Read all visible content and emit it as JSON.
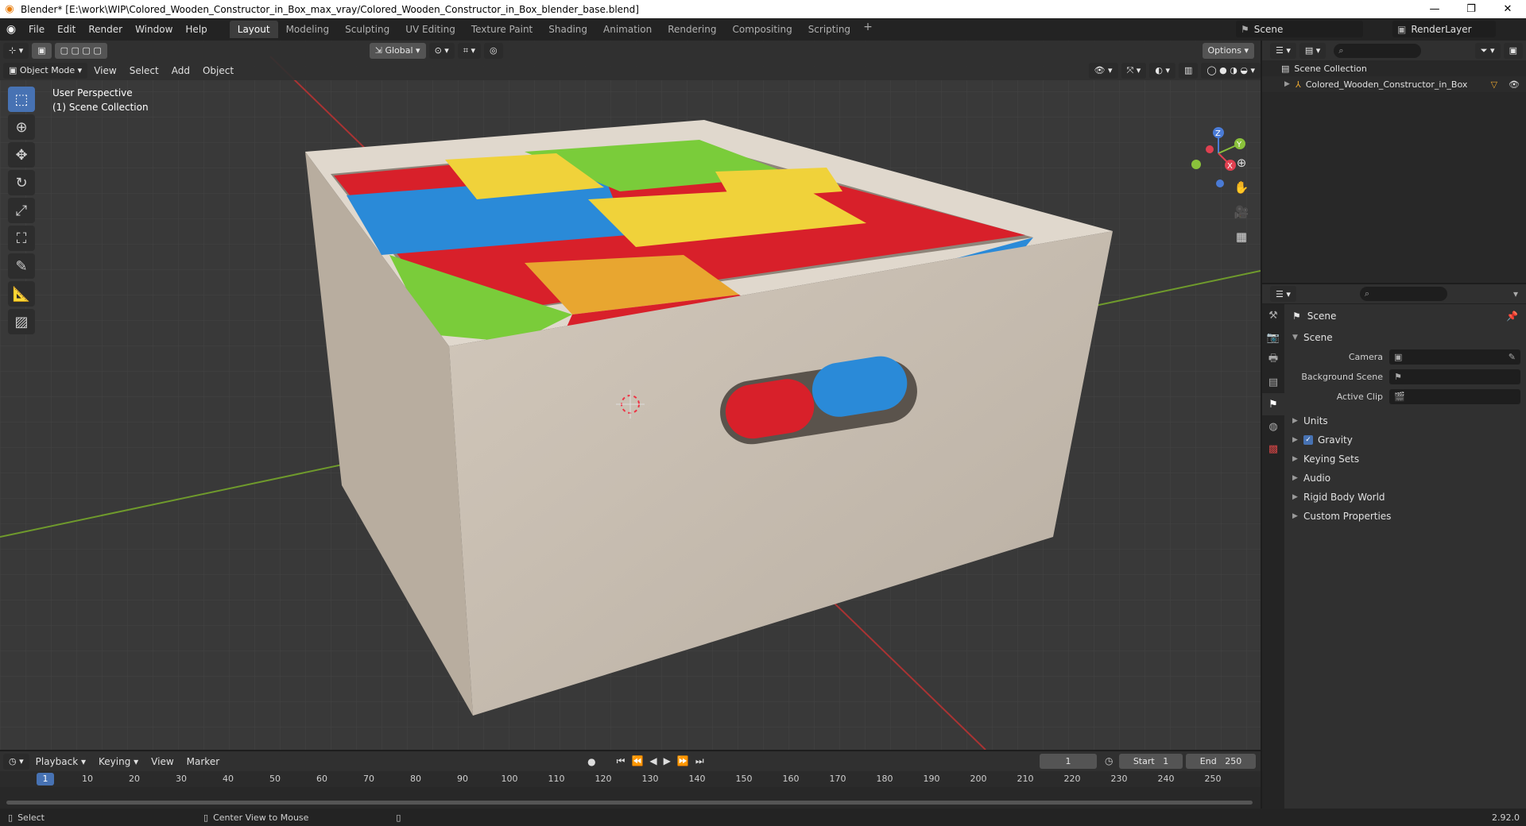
{
  "window": {
    "title": "Blender* [E:\\work\\WIP\\Colored_Wooden_Constructor_in_Box_max_vray/Colored_Wooden_Constructor_in_Box_blender_base.blend]",
    "controls": [
      "—",
      "❐",
      "✕"
    ]
  },
  "menu": [
    "File",
    "Edit",
    "Render",
    "Window",
    "Help"
  ],
  "workspaces": [
    "Layout",
    "Modeling",
    "Sculpting",
    "UV Editing",
    "Texture Paint",
    "Shading",
    "Animation",
    "Rendering",
    "Compositing",
    "Scripting"
  ],
  "active_workspace": "Layout",
  "scene_name": "Scene",
  "render_layer": "RenderLayer",
  "viewport": {
    "mode": "Object Mode",
    "menus": [
      "View",
      "Select",
      "Add",
      "Object"
    ],
    "orientation": "Global",
    "options_label": "Options",
    "info_line1": "User Perspective",
    "info_line2": "(1) Scene Collection",
    "gizmo_axes": [
      "Z",
      "Y",
      "X"
    ]
  },
  "tools": [
    "select-box",
    "cursor",
    "move",
    "rotate",
    "scale",
    "transform",
    "annotate",
    "measure",
    "add-cube"
  ],
  "outliner": {
    "root": "Scene Collection",
    "items": [
      "Colored_Wooden_Constructor_in_Box"
    ]
  },
  "properties": {
    "context": "Scene",
    "panel": "Scene",
    "fields": [
      {
        "label": "Camera",
        "value": ""
      },
      {
        "label": "Background Scene",
        "value": ""
      },
      {
        "label": "Active Clip",
        "value": ""
      }
    ],
    "sections": [
      "Units",
      "Gravity",
      "Keying Sets",
      "Audio",
      "Rigid Body World",
      "Custom Properties"
    ],
    "gravity_enabled": true
  },
  "timeline": {
    "menus": [
      "Playback",
      "Keying",
      "View",
      "Marker"
    ],
    "current_frame": "1",
    "start_label": "Start",
    "start": "1",
    "end_label": "End",
    "end": "250",
    "ruler_ticks": [
      "10",
      "20",
      "30",
      "40",
      "50",
      "60",
      "70",
      "80",
      "90",
      "100",
      "110",
      "120",
      "130",
      "140",
      "150",
      "160",
      "170",
      "180",
      "190",
      "200",
      "210",
      "220",
      "230",
      "240",
      "250"
    ]
  },
  "statusbar": {
    "left": "Select",
    "middle": "Center View to Mouse",
    "version": "2.92.0"
  },
  "colors": {
    "accent": "#4772b3",
    "box_wood": "#c9bfb2",
    "block_red": "#d8202a",
    "block_blue": "#2a8ad8",
    "block_green": "#7acc3a",
    "block_yellow": "#f0d23a",
    "block_orange": "#e8a630"
  }
}
